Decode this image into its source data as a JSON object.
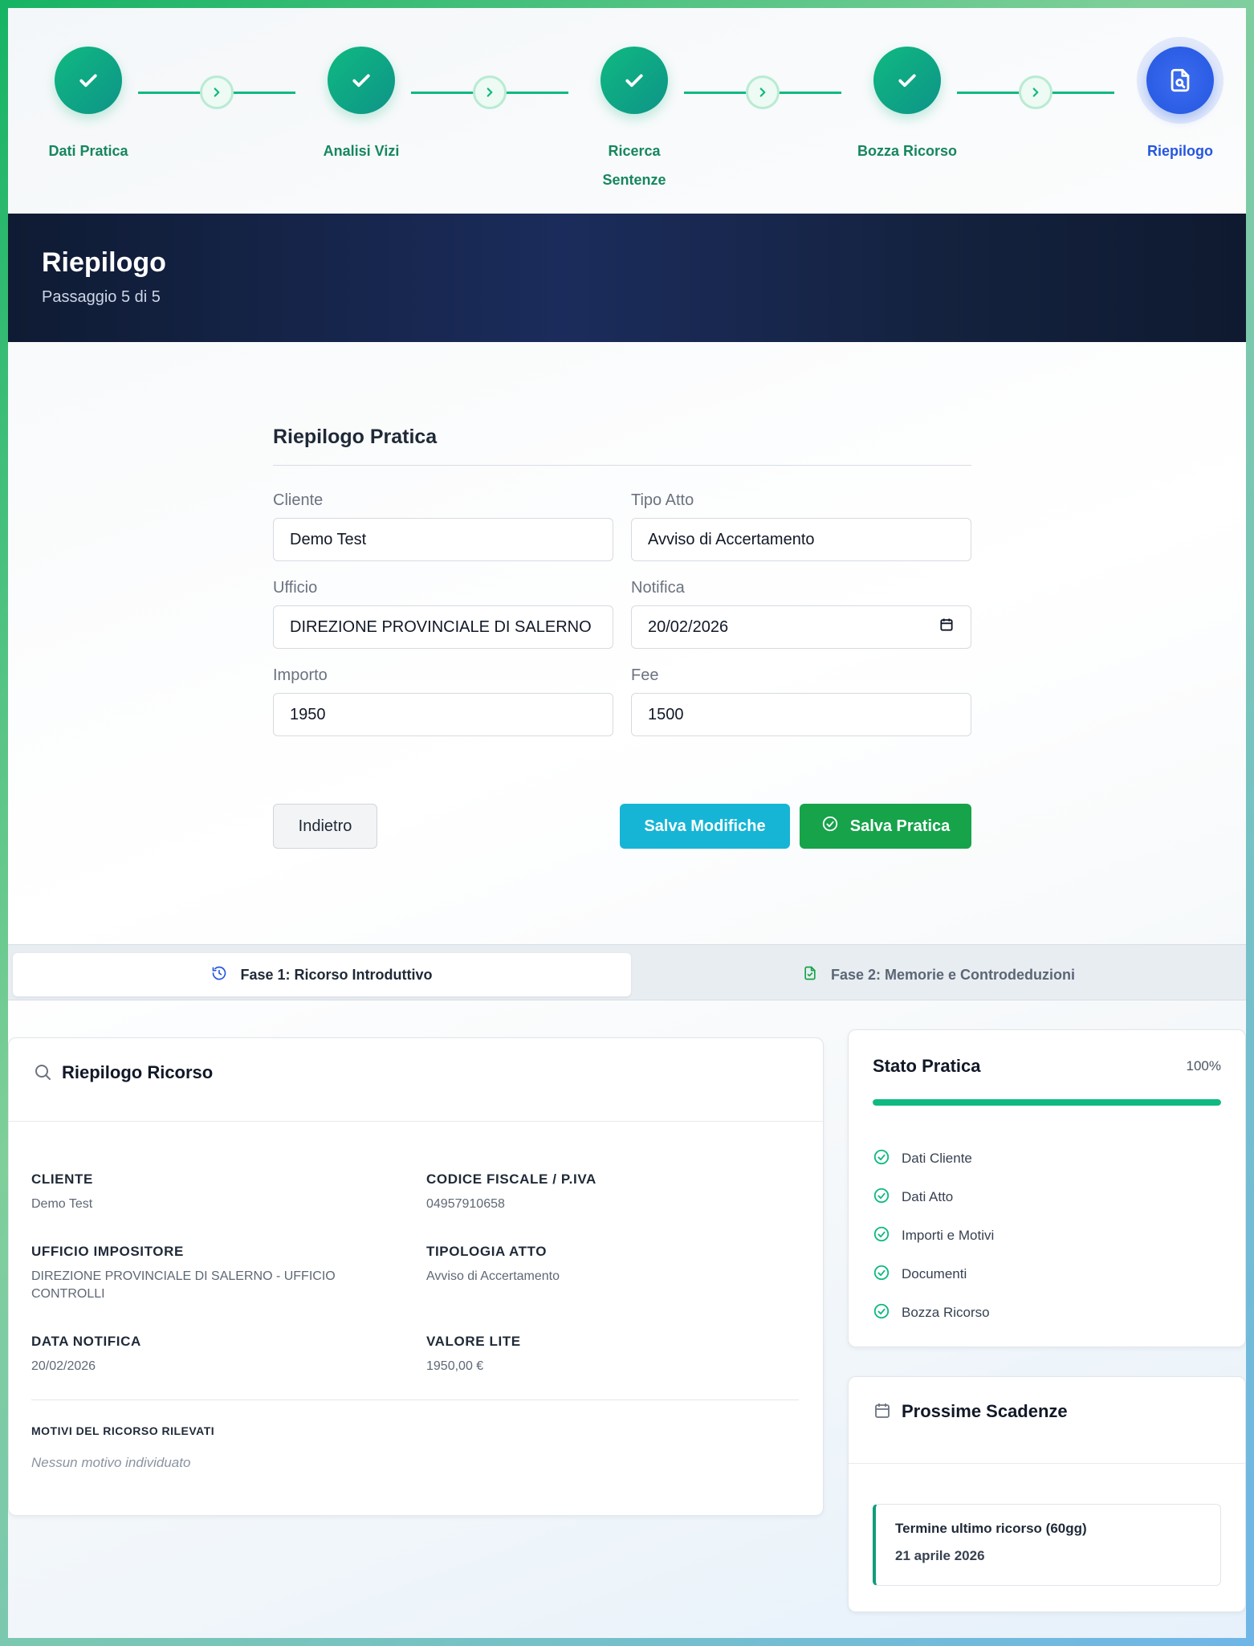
{
  "colors": {
    "step_done": "#10b981",
    "step_active": "#2456e0",
    "header_bg": "#0f1b33",
    "save_modifiche": "#16b5d6",
    "save_pratica": "#16a34a",
    "progress": "#10b981"
  },
  "stepper": {
    "steps": [
      {
        "label": "Dati Pratica",
        "status": "done",
        "icon": "check-icon"
      },
      {
        "label": "Analisi Vizi",
        "status": "done",
        "icon": "check-icon"
      },
      {
        "label_line1": "Ricerca",
        "label_line2": "Sentenze",
        "status": "done",
        "icon": "check-icon"
      },
      {
        "label": "Bozza Ricorso",
        "status": "done",
        "icon": "check-icon"
      },
      {
        "label": "Riepilogo",
        "status": "active",
        "icon": "document-search-icon"
      }
    ]
  },
  "header": {
    "title": "Riepilogo",
    "subtitle": "Passaggio 5 di 5"
  },
  "form": {
    "title": "Riepilogo Pratica",
    "fields": {
      "cliente": {
        "label": "Cliente",
        "value": "Demo Test"
      },
      "tipo_atto": {
        "label": "Tipo Atto",
        "value": "Avviso di Accertamento"
      },
      "ufficio": {
        "label": "Ufficio",
        "value": "DIREZIONE PROVINCIALE DI SALERNO"
      },
      "notifica": {
        "label": "Notifica",
        "value": "20/02/2026"
      },
      "importo": {
        "label": "Importo",
        "value": "1950"
      },
      "fee": {
        "label": "Fee",
        "value": "1500"
      }
    },
    "buttons": {
      "back": "Indietro",
      "save_modifiche": "Salva Modifiche",
      "save_pratica": "Salva Pratica"
    }
  },
  "tabs": [
    {
      "label": "Fase 1: Ricorso Introduttivo",
      "active": true,
      "icon": "history-icon"
    },
    {
      "label": "Fase 2: Memorie e Controdeduzioni",
      "active": false,
      "icon": "file-check-icon"
    }
  ],
  "summary": {
    "title": "Riepilogo Ricorso",
    "items": [
      {
        "key": "CLIENTE",
        "value": "Demo Test"
      },
      {
        "key": "CODICE FISCALE / P.IVA",
        "value": "04957910658"
      },
      {
        "key": "UFFICIO IMPOSITORE",
        "value": "DIREZIONE PROVINCIALE DI SALERNO - UFFICIO CONTROLLI"
      },
      {
        "key": "TIPOLOGIA ATTO",
        "value": "Avviso di Accertamento"
      },
      {
        "key": "DATA NOTIFICA",
        "value": "20/02/2026"
      },
      {
        "key": "VALORE LITE",
        "value": "1950,00 €"
      }
    ],
    "motivi_title": "MOTIVI DEL RICORSO RILEVATI",
    "motivi_value": "Nessun motivo individuato"
  },
  "stato": {
    "title": "Stato Pratica",
    "percent_label": "100%",
    "progress": 1.0,
    "checks": [
      "Dati Cliente",
      "Dati Atto",
      "Importi e Motivi",
      "Documenti",
      "Bozza Ricorso"
    ]
  },
  "scadenze": {
    "title": "Prossime Scadenze",
    "items": [
      {
        "title": "Termine ultimo ricorso (60gg)",
        "date": "21 aprile 2026"
      }
    ]
  }
}
